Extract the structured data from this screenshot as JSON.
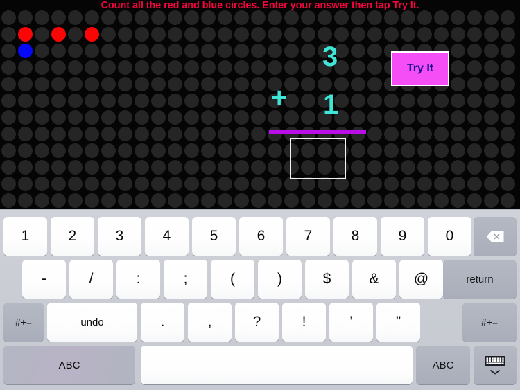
{
  "instruction": {
    "text": "Count all the red and blue circles. Enter your answer then tap Try It.",
    "color": "#f2053f"
  },
  "grid": {
    "rows": 12,
    "cols": 31,
    "cell": 24,
    "dot_diameter": 21,
    "dot_color": "#252525",
    "background": "#050505",
    "colored_circles": [
      {
        "row": 1,
        "col": 1,
        "color": "red"
      },
      {
        "row": 1,
        "col": 3,
        "color": "red"
      },
      {
        "row": 1,
        "col": 5,
        "color": "red"
      },
      {
        "row": 2,
        "col": 1,
        "color": "blue"
      }
    ],
    "red_count": 3,
    "blue_count": 1
  },
  "equation": {
    "operand_top": "3",
    "operator": "+",
    "operand_bottom": "1",
    "answer": "",
    "glyph_color": "#3fe6d8",
    "rule_color": "#b80ee8",
    "answer_box_border": "#f2f2f2"
  },
  "try_it_button": {
    "label": "Try It",
    "background": "#f64ef6",
    "text_color": "#10108c",
    "border_color": "#ffffff"
  },
  "keyboard": {
    "row1": [
      {
        "label": "1",
        "style": "light"
      },
      {
        "label": "2",
        "style": "light"
      },
      {
        "label": "3",
        "style": "light"
      },
      {
        "label": "4",
        "style": "light"
      },
      {
        "label": "5",
        "style": "light"
      },
      {
        "label": "6",
        "style": "light"
      },
      {
        "label": "7",
        "style": "light"
      },
      {
        "label": "8",
        "style": "light"
      },
      {
        "label": "9",
        "style": "light"
      },
      {
        "label": "0",
        "style": "light"
      }
    ],
    "backspace": {
      "icon": "backspace-icon",
      "style": "dark"
    },
    "row2": [
      {
        "label": "-",
        "style": "light"
      },
      {
        "label": "/",
        "style": "light"
      },
      {
        "label": ":",
        "style": "light"
      },
      {
        "label": ";",
        "style": "light"
      },
      {
        "label": "(",
        "style": "light"
      },
      {
        "label": ")",
        "style": "light"
      },
      {
        "label": "$",
        "style": "light"
      },
      {
        "label": "&",
        "style": "light"
      },
      {
        "label": "@",
        "style": "light"
      }
    ],
    "return_key": {
      "label": "return",
      "style": "dark"
    },
    "row3": {
      "symbols_left": {
        "label": "#+=",
        "style": "dark"
      },
      "undo": {
        "label": "undo",
        "style": "light"
      },
      "keys": [
        {
          "label": ".",
          "style": "light"
        },
        {
          "label": ",",
          "style": "light"
        },
        {
          "label": "?",
          "style": "light"
        },
        {
          "label": "!",
          "style": "light"
        },
        {
          "label": "’",
          "style": "light"
        },
        {
          "label": "”",
          "style": "light"
        }
      ],
      "symbols_right": {
        "label": "#+=",
        "style": "dark"
      }
    },
    "row4": {
      "abc_left": {
        "label": "ABC",
        "style": "abc-left"
      },
      "space": {
        "label": "",
        "style": "space"
      },
      "abc_right": {
        "label": "ABC",
        "style": "dark"
      },
      "hide_keyboard": {
        "icon": "hide-keyboard-icon",
        "style": "dark"
      }
    }
  }
}
